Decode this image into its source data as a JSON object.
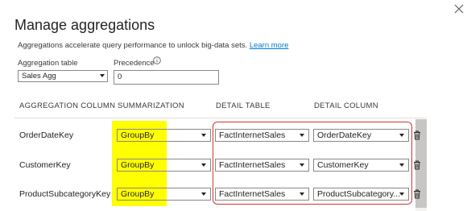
{
  "dialog": {
    "title": "Manage aggregations",
    "description": "Aggregations accelerate query performance to unlock big-data sets.",
    "learn_more": "Learn more"
  },
  "aggregation_table": {
    "label": "Aggregation table",
    "value": "Sales Agg"
  },
  "precedence": {
    "label": "Precedence",
    "value": "0"
  },
  "columns": {
    "aggregation_column": "AGGREGATION COLUMN",
    "summarization": "SUMMARIZATION",
    "detail_table": "DETAIL TABLE",
    "detail_column": "DETAIL COLUMN"
  },
  "rows": [
    {
      "column": "OrderDateKey",
      "summarization": "GroupBy",
      "detail_table": "FactInternetSales",
      "detail_column": "OrderDateKey"
    },
    {
      "column": "CustomerKey",
      "summarization": "GroupBy",
      "detail_table": "FactInternetSales",
      "detail_column": "CustomerKey"
    },
    {
      "column": "ProductSubcategoryKey",
      "summarization": "GroupBy",
      "detail_table": "FactInternetSales",
      "detail_column": "ProductSubcategory..."
    }
  ],
  "colors": {
    "highlight": "#ffff00",
    "outline": "#d13438",
    "link": "#0078d4"
  },
  "icons": {
    "close": "close-icon",
    "info": "info-icon",
    "dropdown": "chevron-down-icon",
    "delete": "trash-icon"
  }
}
